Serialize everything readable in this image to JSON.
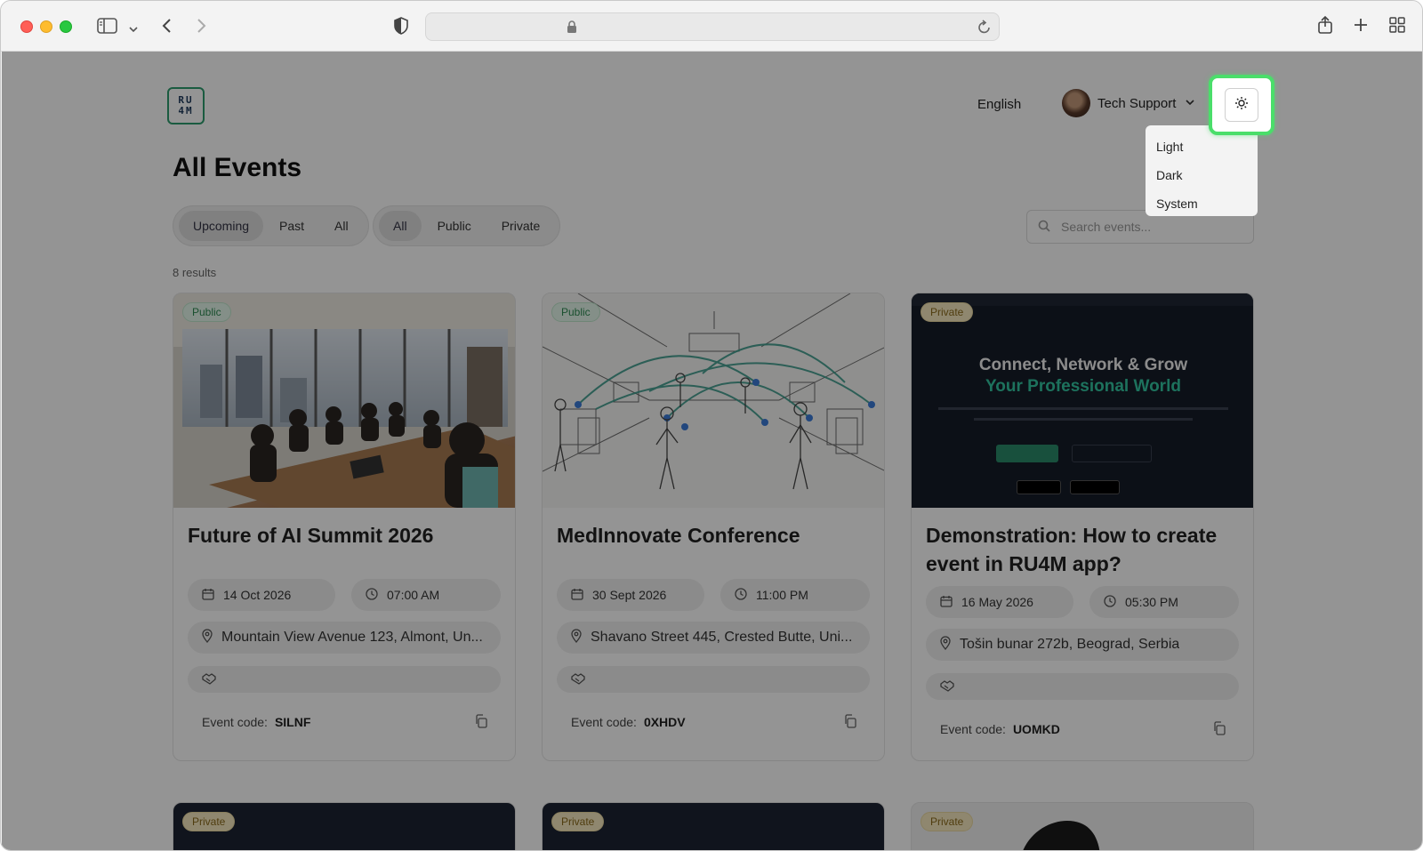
{
  "browser": {
    "url": ""
  },
  "header": {
    "logo_text_top": "RU",
    "logo_text_bottom": "4M",
    "language": "English",
    "user_name": "Tech Support"
  },
  "theme_menu": {
    "items": [
      "Light",
      "Dark",
      "System"
    ]
  },
  "main": {
    "title": "All Events",
    "time_filters": [
      "Upcoming",
      "Past",
      "All"
    ],
    "active_time_filter": "Upcoming",
    "visibility_filters": [
      "All",
      "Public",
      "Private"
    ],
    "active_visibility_filter": "All",
    "search_placeholder": "Search events...",
    "results_count": "8 results"
  },
  "cards": [
    {
      "badge": "Public",
      "title": "Future of AI Summit 2026",
      "date": "14 Oct 2026",
      "time": "07:00 AM",
      "location": "Mountain View Avenue 123, Almont, Un...",
      "code_label": "Event code:",
      "code": "SILNF"
    },
    {
      "badge": "Public",
      "title": "MedInnovate Conference",
      "date": "30 Sept 2026",
      "time": "11:00 PM",
      "location": "Shavano Street 445, Crested Butte, Uni...",
      "code_label": "Event code:",
      "code": "0XHDV"
    },
    {
      "badge": "Private",
      "title": "Demonstration: How to create event in RU4M app?",
      "date": "16 May 2026",
      "time": "05:30 PM",
      "location": "Tošin bunar 272b, Beograd, Serbia",
      "code_label": "Event code:",
      "code": "UOMKD",
      "promo_line1": "Connect, Network & Grow",
      "promo_line2": "Your Professional World"
    }
  ],
  "next_cards": [
    {
      "badge": "Private"
    },
    {
      "badge": "Private"
    },
    {
      "badge": "Private"
    }
  ]
}
